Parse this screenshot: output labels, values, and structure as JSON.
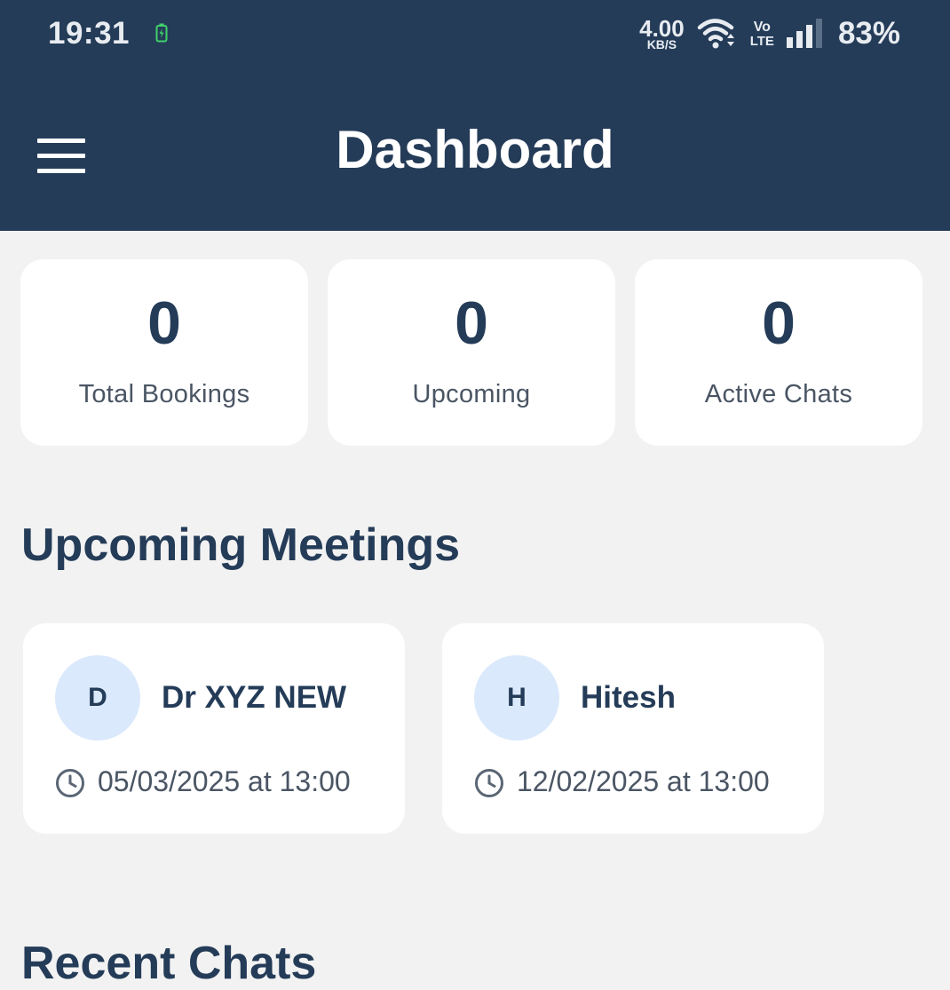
{
  "status_bar": {
    "time": "19:31",
    "net_speed_value": "4.00",
    "net_speed_unit": "KB/S",
    "volte_top": "Vo",
    "volte_bottom": "LTE",
    "battery_percent": "83%"
  },
  "header": {
    "title": "Dashboard",
    "menu_icon": "hamburger-menu-icon"
  },
  "stats": [
    {
      "value": "0",
      "label": "Total Bookings"
    },
    {
      "value": "0",
      "label": "Upcoming"
    },
    {
      "value": "0",
      "label": "Active Chats"
    }
  ],
  "upcoming_meetings": {
    "title": "Upcoming Meetings",
    "items": [
      {
        "initial": "D",
        "name": "Dr XYZ NEW",
        "datetime": "05/03/2025 at 13:00"
      },
      {
        "initial": "H",
        "name": "Hitesh",
        "datetime": "12/02/2025 at 13:00"
      }
    ]
  },
  "recent_chats": {
    "title": "Recent Chats"
  },
  "colors": {
    "header_bg": "#243c58",
    "page_bg": "#f2f2f2",
    "avatar_bg": "#dbe9fc",
    "text_primary": "#243c58",
    "text_secondary": "#4a5564"
  }
}
